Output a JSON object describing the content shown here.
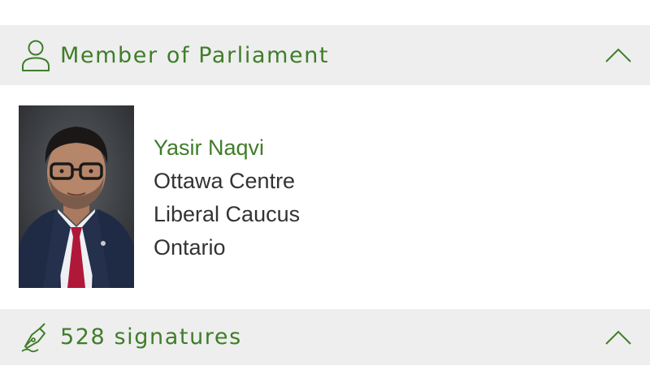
{
  "mp_section": {
    "title": "Member of Parliament",
    "icon": "person-icon",
    "toggle_icon": "chevron-up-icon"
  },
  "member": {
    "name": "Yasir Naqvi",
    "riding": "Ottawa Centre",
    "caucus": "Liberal Caucus",
    "province": "Ontario"
  },
  "signatures_section": {
    "title": "528 signatures",
    "icon": "signature-pen-icon",
    "toggle_icon": "chevron-up-icon"
  },
  "colors": {
    "accent": "#3f7d2a",
    "header_bg": "#eeeeee",
    "text": "#333333"
  }
}
